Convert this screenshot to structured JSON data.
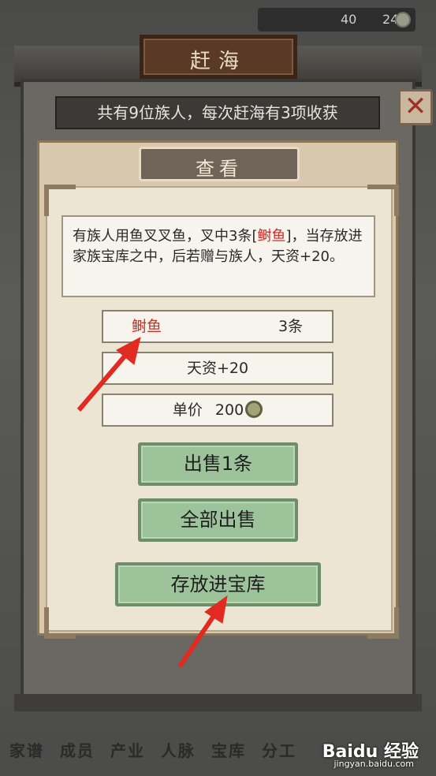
{
  "status": {
    "resource_a": "40",
    "resource_b": "24"
  },
  "title": "赶海",
  "info_bar": "共有9位族人，每次赶海有3项收获",
  "close_label": "✕",
  "dialog": {
    "header": "查看",
    "description": {
      "part1": "有族人用鱼叉叉鱼，叉中3条[",
      "highlight": "鲥鱼",
      "part2": "]，当存放进家族宝库之中，后若赠与族人，天资+20。"
    },
    "item": {
      "name": "鲥鱼",
      "count": "3条"
    },
    "attribute": "天资+20",
    "price": {
      "label": "单价",
      "value": "200"
    },
    "buttons": {
      "sell_one": "出售1条",
      "sell_all": "全部出售",
      "store": "存放进宝库"
    }
  },
  "bottom_tabs": [
    "家谱",
    "成员",
    "产业",
    "人脉",
    "宝库",
    "分工"
  ],
  "watermark": {
    "brand": "Baidu 经验",
    "url": "jingyan.baidu.com"
  },
  "colors": {
    "highlight": "#d42c26",
    "button_green": "#9cc39a",
    "arrow": "#e02a22"
  }
}
